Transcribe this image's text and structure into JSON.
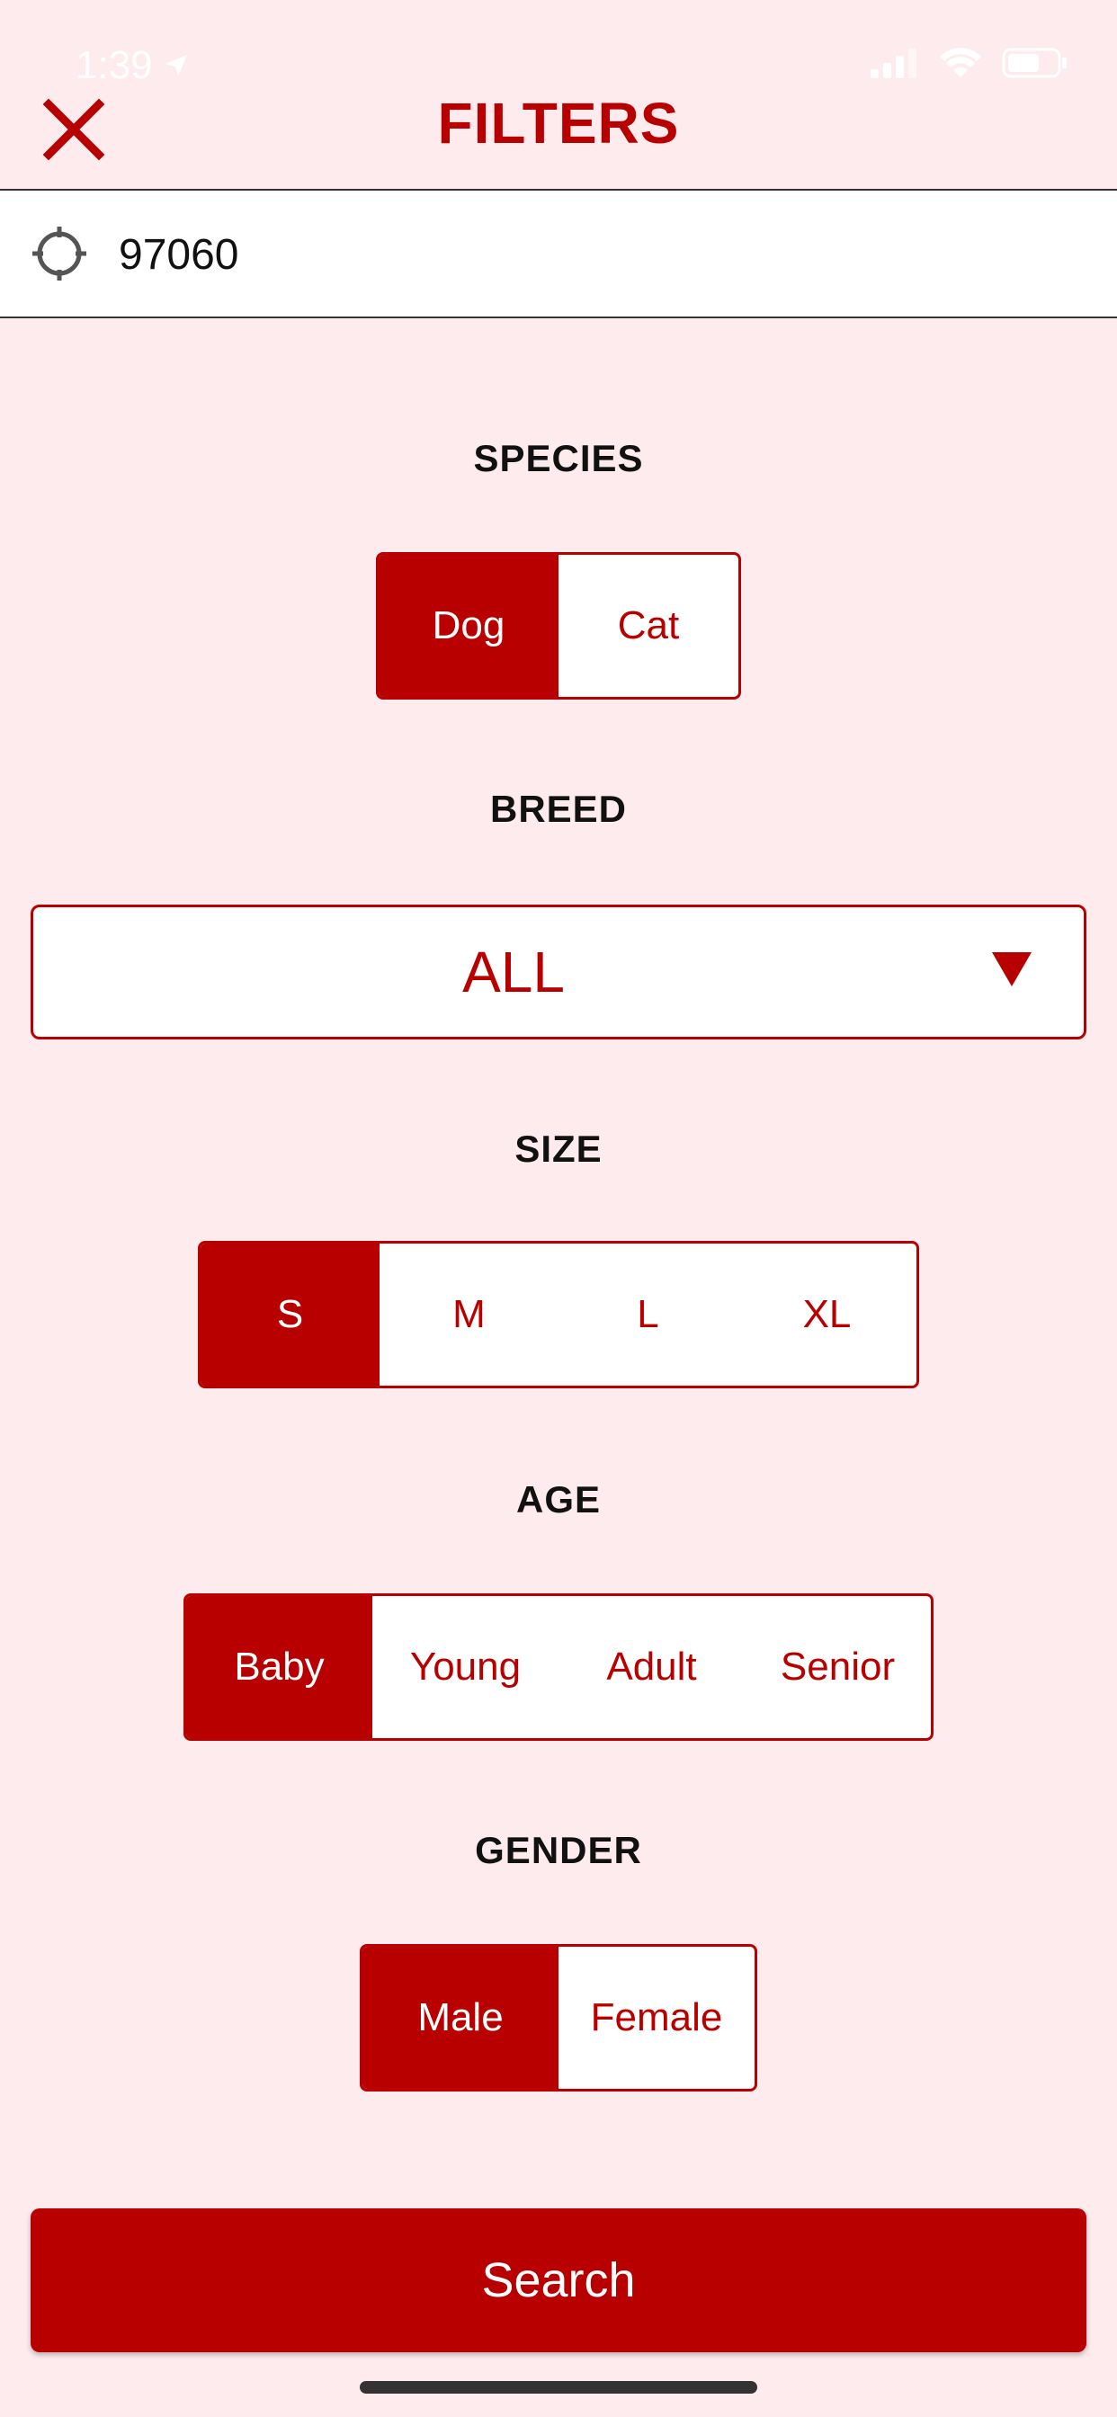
{
  "status_bar": {
    "time": "1:39"
  },
  "header": {
    "title": "FILTERS"
  },
  "location": {
    "value": "97060"
  },
  "species": {
    "label": "SPECIES",
    "options": [
      "Dog",
      "Cat"
    ],
    "selected": "Dog"
  },
  "breed": {
    "label": "BREED",
    "value": "ALL"
  },
  "size": {
    "label": "SIZE",
    "options": [
      "S",
      "M",
      "L",
      "XL"
    ],
    "selected": "S"
  },
  "age": {
    "label": "AGE",
    "options": [
      "Baby",
      "Young",
      "Adult",
      "Senior"
    ],
    "selected": "Baby"
  },
  "gender": {
    "label": "GENDER",
    "options": [
      "Male",
      "Female"
    ],
    "selected": "Male"
  },
  "search_button": {
    "label": "Search"
  },
  "colors": {
    "accent": "#b80000",
    "background": "#fdebed"
  }
}
